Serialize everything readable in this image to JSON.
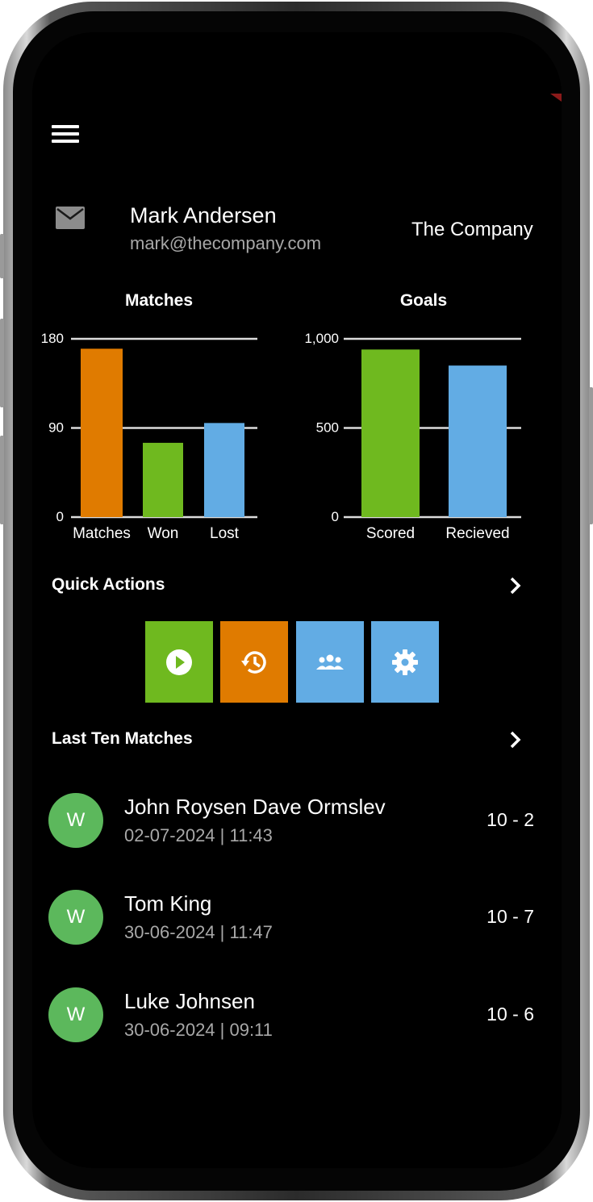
{
  "header": {
    "menu_icon": "hamburger-menu-icon",
    "mail_icon": "envelope-icon"
  },
  "user": {
    "name": "Mark Andersen",
    "email": "mark@thecompany.com",
    "company": "The Company"
  },
  "colors": {
    "orange": "#e07b00",
    "green": "#6fb91f",
    "blue": "#62ace4",
    "avatar_green": "#5cb85c",
    "background": "#000000"
  },
  "chart_data": [
    {
      "type": "bar",
      "title": "Matches",
      "categories": [
        "Matches",
        "Won",
        "Lost"
      ],
      "values": [
        170,
        75,
        95
      ],
      "colors": [
        "#e07b00",
        "#6fb91f",
        "#62ace4"
      ],
      "ylim": [
        0,
        180
      ],
      "yticks": [
        "0",
        "90",
        "180"
      ],
      "grid": true
    },
    {
      "type": "bar",
      "title": "Goals",
      "categories": [
        "Scored",
        "Recieved"
      ],
      "values": [
        940,
        850
      ],
      "colors": [
        "#6fb91f",
        "#62ace4"
      ],
      "ylim": [
        0,
        1000
      ],
      "yticks": [
        "0",
        "500",
        "1,000"
      ],
      "grid": true
    }
  ],
  "quick_actions": {
    "title": "Quick Actions",
    "items": [
      {
        "icon": "play-icon",
        "color": "#6fb91f"
      },
      {
        "icon": "history-icon",
        "color": "#e07b00"
      },
      {
        "icon": "group-icon",
        "color": "#62ace4"
      },
      {
        "icon": "gear-icon",
        "color": "#62ace4"
      }
    ]
  },
  "last_matches": {
    "title": "Last Ten Matches",
    "items": [
      {
        "result": "W",
        "opponent": "John Roysen Dave Ormslev",
        "date": "02-07-2024 | 11:43",
        "score": "10 - 2"
      },
      {
        "result": "W",
        "opponent": "Tom King",
        "date": "30-06-2024 | 11:47",
        "score": "10 - 7"
      },
      {
        "result": "W",
        "opponent": "Luke Johnsen",
        "date": "30-06-2024 | 09:11",
        "score": "10 - 6"
      }
    ]
  }
}
